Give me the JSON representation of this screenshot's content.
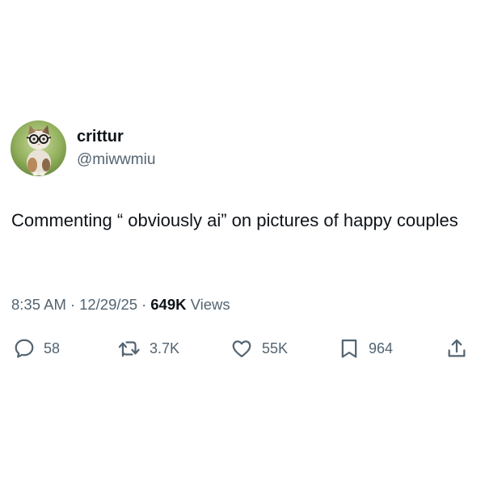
{
  "author": {
    "display_name": "crittur",
    "handle": "@miwwmiu",
    "avatar_icon": "cat-with-glasses-avatar"
  },
  "tweet": {
    "text": "Commenting “ obviously ai” on pictures of happy couples"
  },
  "meta": {
    "time": "8:35 AM",
    "separator": "·",
    "date": "12/29/25",
    "views_count": "649K",
    "views_label": "Views"
  },
  "actions": {
    "replies": {
      "icon": "reply-icon",
      "count": "58"
    },
    "reposts": {
      "icon": "repost-icon",
      "count": "3.7K"
    },
    "likes": {
      "icon": "heart-icon",
      "count": "55K"
    },
    "bookmarks": {
      "icon": "bookmark-icon",
      "count": "964"
    },
    "share": {
      "icon": "share-icon"
    }
  },
  "colors": {
    "text_primary": "#0f1419",
    "text_secondary": "#536471",
    "background": "#ffffff"
  }
}
